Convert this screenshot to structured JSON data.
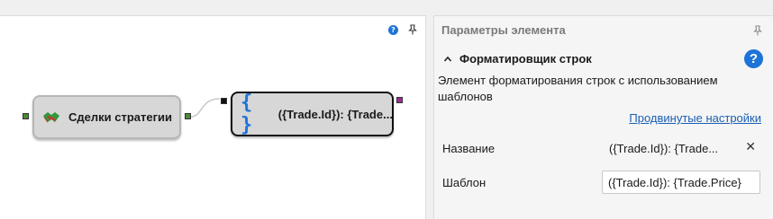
{
  "canvas": {
    "nodes": [
      {
        "label": "Сделки стратегии",
        "icon": "handshake-icon"
      },
      {
        "label": "({Trade.Id}): {Trade...",
        "icon": "curly-braces-icon",
        "icon_text": "{ }"
      }
    ],
    "toolbar": {
      "help_label": "?",
      "pin_icon": "pin-icon"
    }
  },
  "panel": {
    "title": "Параметры элемента",
    "section_title": "Форматировщик строк",
    "help_label": "?",
    "description": "Элемент форматирования строк с использованием шаблонов",
    "advanced_link": "Продвинутые настройки",
    "fields": {
      "name_label": "Название",
      "name_value": "({Trade.Id}): {Trade...",
      "template_label": "Шаблон",
      "template_value": "({Trade.Id}): {Trade.Price}"
    }
  },
  "colors": {
    "accent": "#1e73d8",
    "socket_in": "#4a8a3a",
    "socket_out": "#9c2a9c",
    "link": "#1a5fb4"
  }
}
